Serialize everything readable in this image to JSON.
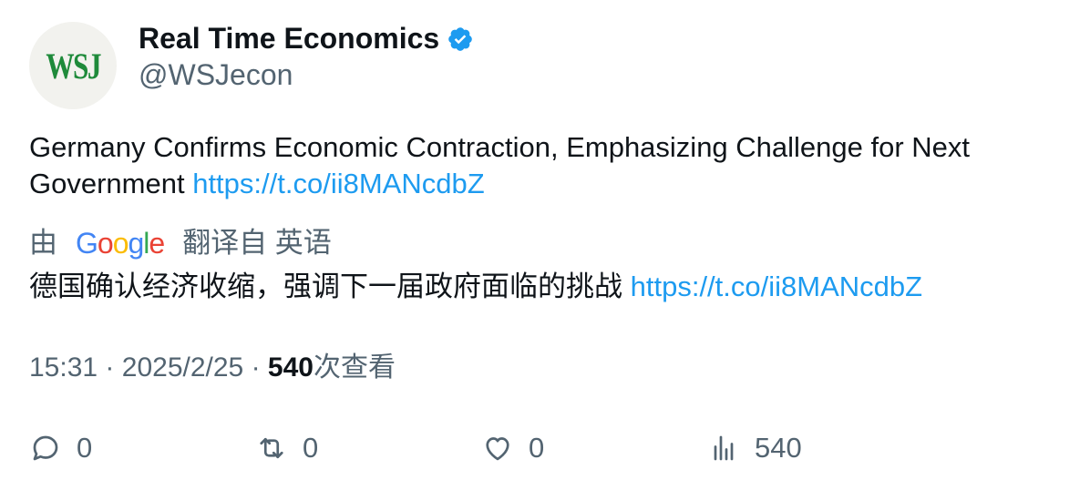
{
  "author": {
    "avatar_text": "WSJ",
    "name": "Real Time Economics",
    "handle": "@WSJecon",
    "verified_icon": "verified-badge-icon",
    "verified_color": "#1d9bf0"
  },
  "tweet": {
    "text": "Germany Confirms Economic Contraction, Emphasizing Challenge for Next Government",
    "link": "https://t.co/ii8MANcdbZ"
  },
  "translation": {
    "prefix": "由",
    "brand": "Google",
    "suffix": "翻译自 英语",
    "text": "德国确认经济收缩，强调下一届政府面临的挑战",
    "link": "https://t.co/ii8MANcdbZ"
  },
  "meta": {
    "time": "15:31",
    "separator": "·",
    "date": "2025/2/25",
    "views_count": "540",
    "views_label": "次查看"
  },
  "actions": {
    "reply_icon": "reply-icon",
    "reply_count": "0",
    "retweet_icon": "retweet-icon",
    "retweet_count": "0",
    "like_icon": "heart-icon",
    "like_count": "0",
    "views_icon": "bar-chart-icon",
    "views_count": "540"
  },
  "colors": {
    "link": "#1d9bf0",
    "secondary_text": "#536471",
    "primary_text": "#0f1419",
    "brand_green": "#1e8a3a"
  }
}
